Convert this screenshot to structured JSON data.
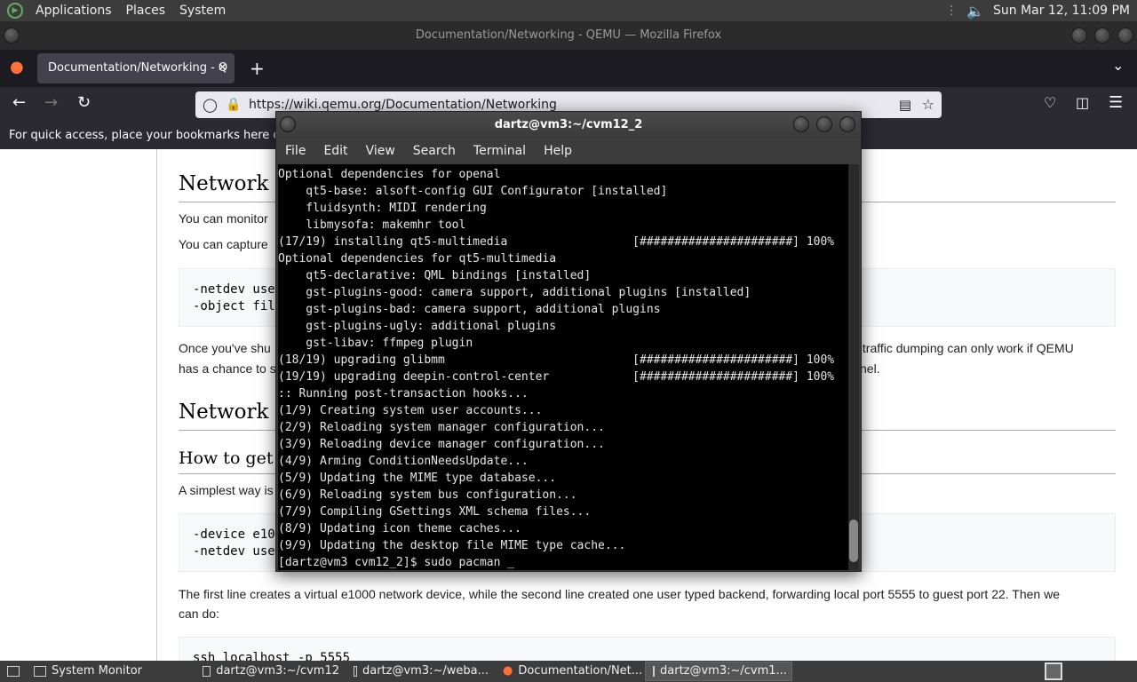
{
  "top_panel": {
    "menus": [
      "Applications",
      "Places",
      "System"
    ],
    "datetime": "Sun Mar 12, 11:09 PM"
  },
  "firefox": {
    "window_title": "Documentation/Networking - QEMU — Mozilla Firefox",
    "tab_title": "Documentation/Networking - Q",
    "url": "https://wiki.qemu.org/Documentation/Networking",
    "bookmarks_hint": "For quick access, place your bookmarks here on the"
  },
  "page": {
    "h_network_m": "Network M",
    "p_monitor": "You can monitor",
    "p_capture": "You can capture",
    "pre1": [
      "-netdev use",
      "-object fil"
    ],
    "p_once_left": "Once you've shu",
    "p_once_right": "k traffic dumping can only work if QEMU",
    "p_chance_left": "has a chance to s",
    "p_chance_right": "nel.",
    "h_network_h": "Network H",
    "h_how_to": "How to get S",
    "p_simplest": "A simplest way is",
    "pre2": [
      "-device e10",
      "-netdev use"
    ],
    "p_first_line": "The first line creates a virtual e1000 network device, while the second line created one user typed backend, forwarding local port 5555 to guest port 22. Then we",
    "p_can_do": "can do:",
    "pre3": "ssh localhost -p 5555"
  },
  "terminal": {
    "title": "dartz@vm3:~/cvm12_2",
    "menus": [
      "File",
      "Edit",
      "View",
      "Search",
      "Terminal",
      "Help"
    ],
    "lines": [
      "Optional dependencies for openal",
      "    qt5-base: alsoft-config GUI Configurator [installed]",
      "    fluidsynth: MIDI rendering",
      "    libmysofa: makemhr tool",
      "(17/19) installing qt5-multimedia                  [######################] 100%",
      "Optional dependencies for qt5-multimedia",
      "    qt5-declarative: QML bindings [installed]",
      "    gst-plugins-good: camera support, additional plugins [installed]",
      "    gst-plugins-bad: camera support, additional plugins",
      "    gst-plugins-ugly: additional plugins",
      "    gst-libav: ffmpeg plugin",
      "(18/19) upgrading glibmm                           [######################] 100%",
      "(19/19) upgrading deepin-control-center            [######################] 100%",
      ":: Running post-transaction hooks...",
      "(1/9) Creating system user accounts...",
      "(2/9) Reloading system manager configuration...",
      "(3/9) Reloading device manager configuration...",
      "(4/9) Arming ConditionNeedsUpdate...",
      "(5/9) Updating the MIME type database...",
      "(6/9) Reloading system bus configuration...",
      "(7/9) Compiling GSettings XML schema files...",
      "(8/9) Updating icon theme caches...",
      "(9/9) Updating the desktop file MIME type cache...",
      "[dartz@vm3 cvm12_2]$ sudo pacman _"
    ]
  },
  "taskbar": {
    "items": [
      "System Monitor",
      "dartz@vm3:~/cvm12",
      "dartz@vm3:~/weba...",
      "Documentation/Net...",
      "dartz@vm3:~/cvm1..."
    ]
  }
}
